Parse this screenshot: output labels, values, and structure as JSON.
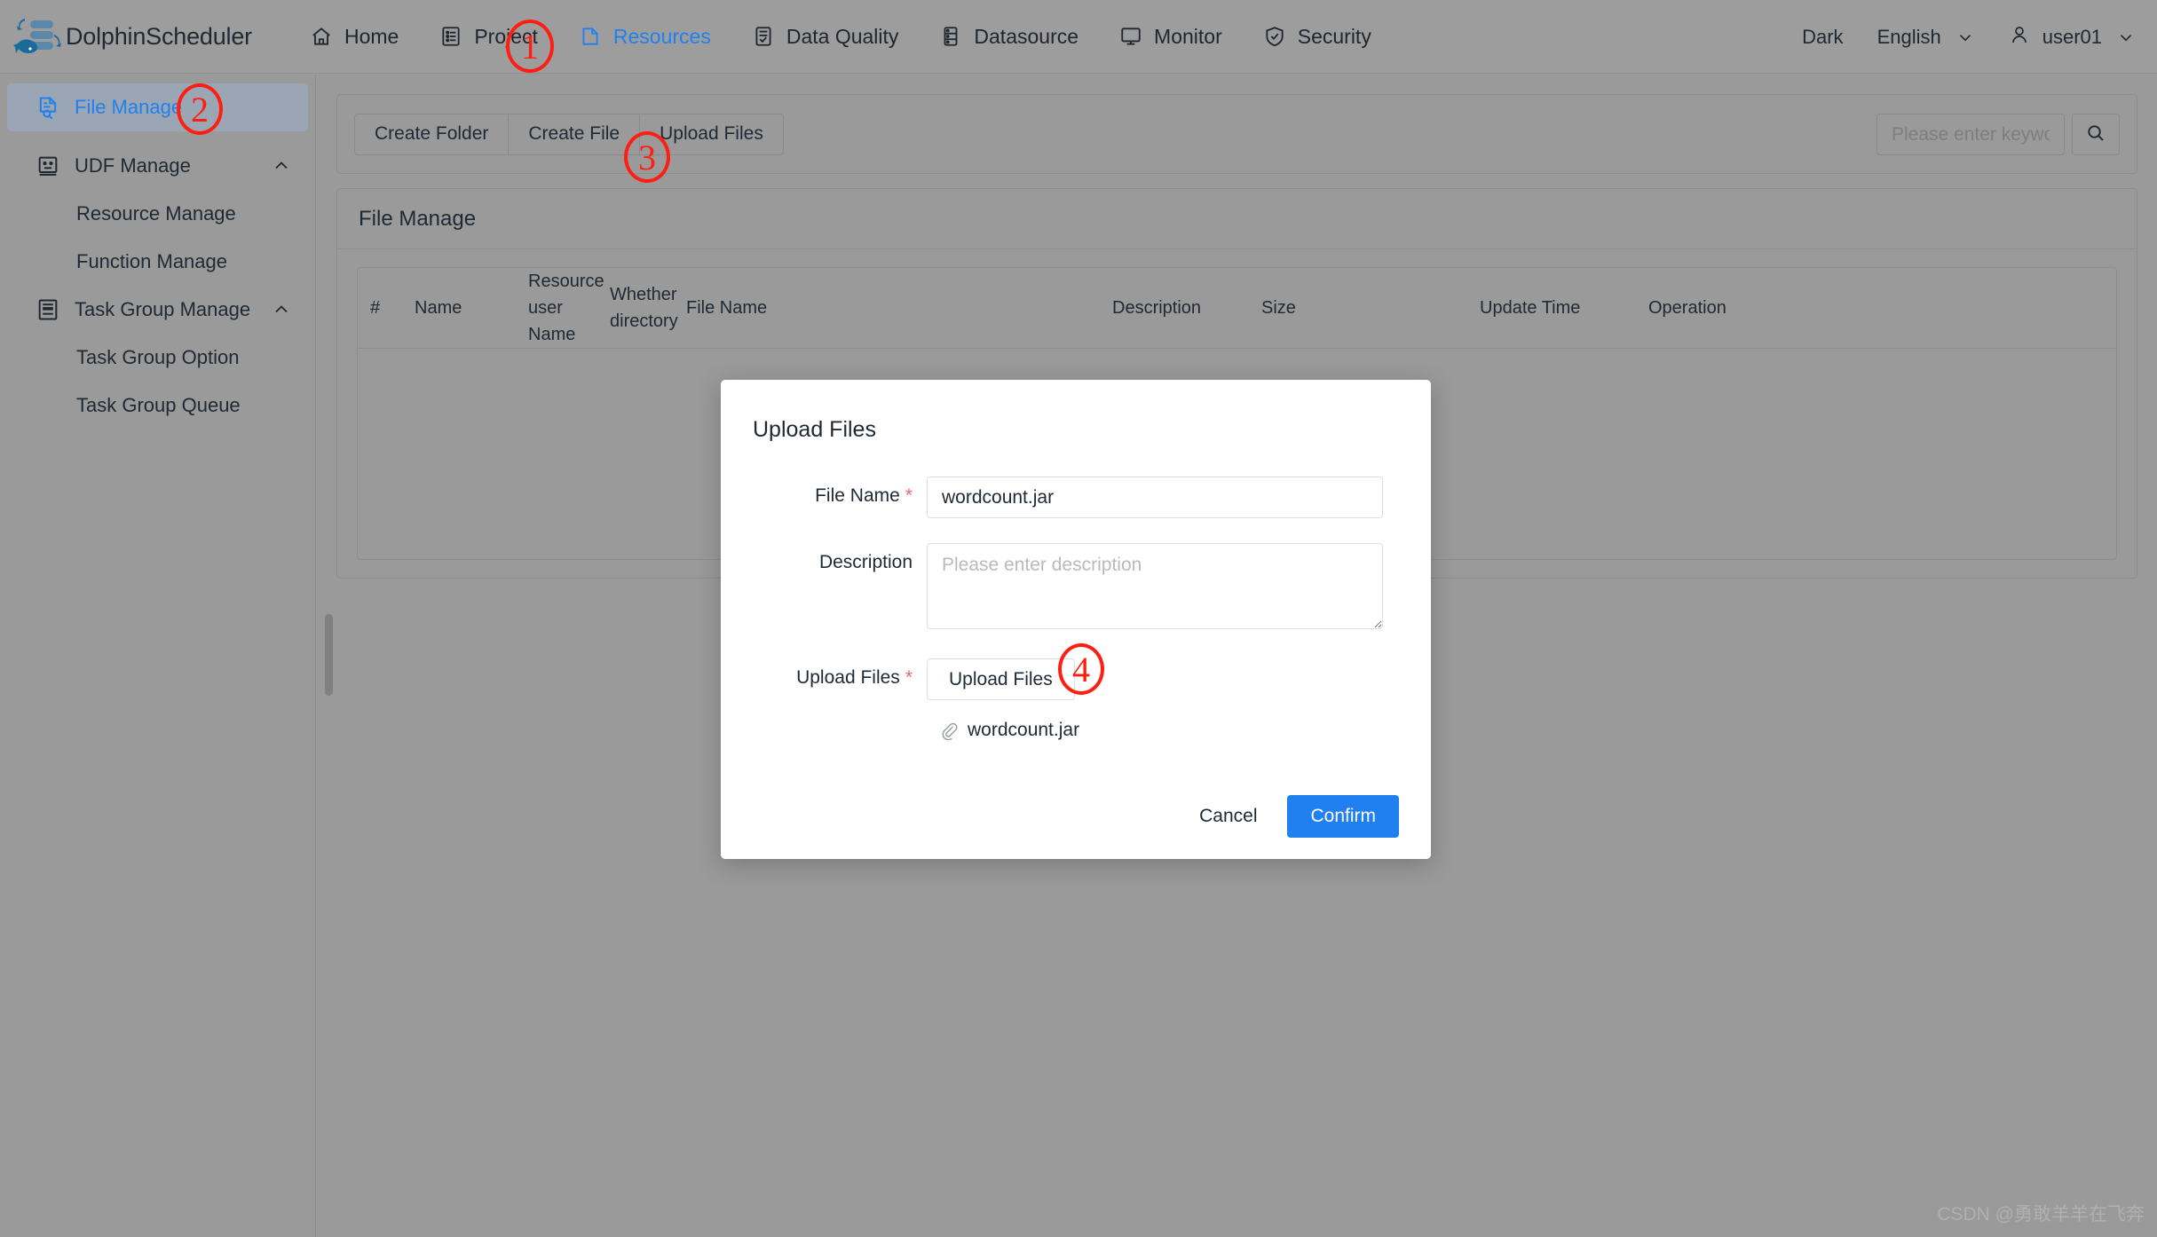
{
  "app": {
    "logo_text": "DolphinScheduler",
    "logo_icon": "dolphin-logo-icon"
  },
  "topnav": {
    "items": [
      {
        "label": "Home",
        "icon": "home-icon",
        "active": false
      },
      {
        "label": "Project",
        "icon": "project-icon",
        "active": false
      },
      {
        "label": "Resources",
        "icon": "resources-icon",
        "active": true
      },
      {
        "label": "Data Quality",
        "icon": "data-quality-icon",
        "active": false
      },
      {
        "label": "Datasource",
        "icon": "datasource-icon",
        "active": false
      },
      {
        "label": "Monitor",
        "icon": "monitor-icon",
        "active": false
      },
      {
        "label": "Security",
        "icon": "security-icon",
        "active": false
      }
    ],
    "theme_label": "Dark",
    "language_label": "English",
    "user_label": "user01"
  },
  "sidebar": {
    "items": [
      {
        "label": "File Manage",
        "icon": "file-manage-icon",
        "active": true,
        "type": "item",
        "expandable": false
      },
      {
        "label": "UDF Manage",
        "icon": "udf-manage-icon",
        "active": false,
        "type": "group",
        "expandable": true
      },
      {
        "label": "Resource Manage",
        "icon": "",
        "active": false,
        "type": "sub",
        "expandable": false
      },
      {
        "label": "Function Manage",
        "icon": "",
        "active": false,
        "type": "sub",
        "expandable": false
      },
      {
        "label": "Task Group Manage",
        "icon": "task-group-manage-icon",
        "active": false,
        "type": "group",
        "expandable": true
      },
      {
        "label": "Task Group Option",
        "icon": "",
        "active": false,
        "type": "sub",
        "expandable": false
      },
      {
        "label": "Task Group Queue",
        "icon": "",
        "active": false,
        "type": "sub",
        "expandable": false
      }
    ]
  },
  "toolbar": {
    "create_folder_label": "Create Folder",
    "create_file_label": "Create File",
    "upload_files_label": "Upload Files",
    "search_placeholder": "Please enter keyword",
    "search_value": "",
    "search_icon": "search-icon"
  },
  "panel": {
    "title": "File Manage",
    "table": {
      "headers": [
        "#",
        "Name",
        "Resource user Name",
        "Whether directory",
        "File Name",
        "Description",
        "Size",
        "Update Time",
        "Operation"
      ],
      "rows": []
    }
  },
  "modal": {
    "title": "Upload Files",
    "fields": {
      "file_name_label": "File Name",
      "file_name_value": "wordcount.jar",
      "file_name_required": "*",
      "description_label": "Description",
      "description_value": "",
      "description_placeholder": "Please enter description",
      "upload_label": "Upload Files",
      "upload_required": "*",
      "upload_button_label": "Upload Files",
      "attached_file_name": "wordcount.jar",
      "attachment_icon": "paperclip-icon"
    },
    "cancel_label": "Cancel",
    "confirm_label": "Confirm"
  },
  "annotations": [
    {
      "number": "1",
      "target": "topnav-resources"
    },
    {
      "number": "2",
      "target": "sidebar-file-manage"
    },
    {
      "number": "3",
      "target": "toolbar-upload-files"
    },
    {
      "number": "4",
      "target": "modal-upload-button"
    }
  ],
  "watermark": "CSDN @勇敢羊羊在飞奔",
  "colors": {
    "accent": "#2080f0",
    "annotation": "#fe1f13",
    "required": "#e8656b",
    "page_bg": "#9a9a9a"
  }
}
